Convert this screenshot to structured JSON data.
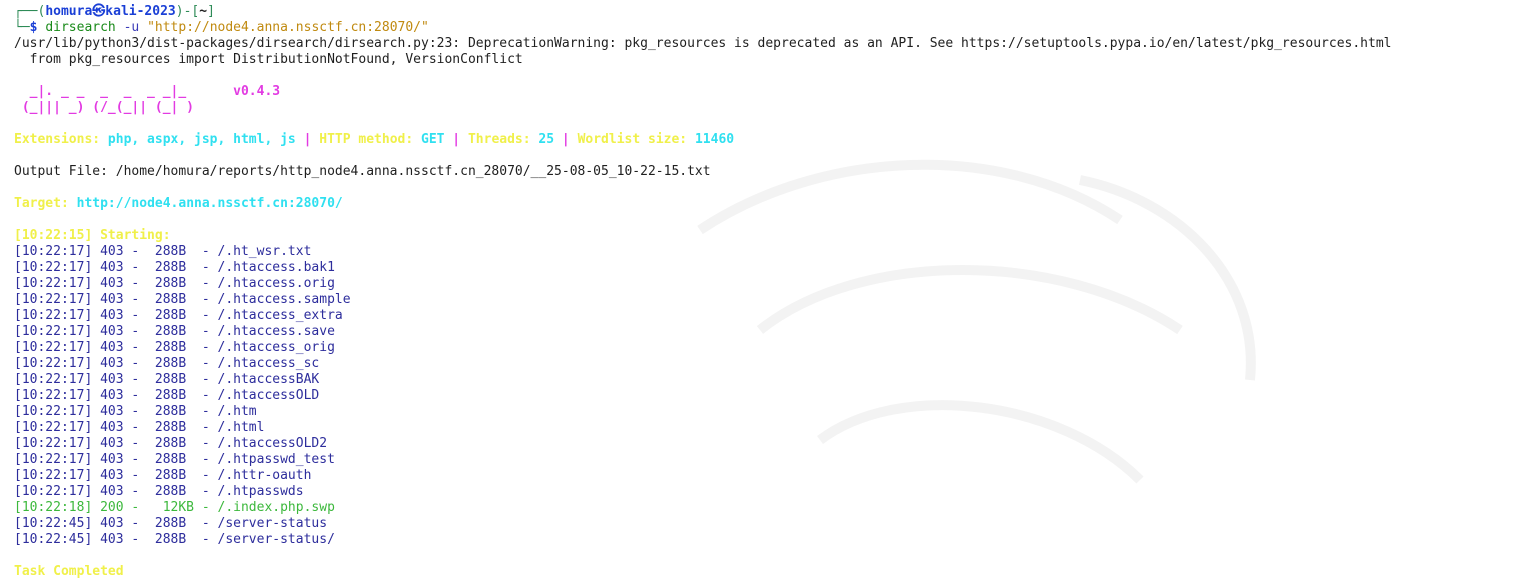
{
  "prompt": {
    "frame_top_left": "┌──(",
    "user": "homura",
    "at_symbol": "㉿",
    "host": "kali-2023",
    "mid": ")-[",
    "cwd": "~",
    "close": "]",
    "frame_bottom": "└─",
    "dollar": "$",
    "command": "dirsearch",
    "flag": "-u",
    "url_arg": "\"http://node4.anna.nssctf.cn:28070/\""
  },
  "warning": {
    "line1": "/usr/lib/python3/dist-packages/dirsearch/dirsearch.py:23: DeprecationWarning: pkg_resources is deprecated as an API. See https://setuptools.pypa.io/en/latest/pkg_resources.html",
    "line2": "  from pkg_resources import DistributionNotFound, VersionConflict"
  },
  "banner": {
    "art_line1": "  _|. _ _  _  _  _ _|_",
    "version": "v0.4.3",
    "art_line2": " (_||| _) (/_(_|| (_| )"
  },
  "config": {
    "ext_label": "Extensions: ",
    "ext_value": "php, aspx, jsp, html, js",
    "sep": " | ",
    "method_label": "HTTP method: ",
    "method_value": "GET",
    "threads_label": "Threads: ",
    "threads_value": "25",
    "wordlist_label": "Wordlist size: ",
    "wordlist_value": "11460"
  },
  "output_file": "Output File: /home/homura/reports/http_node4.anna.nssctf.cn_28070/__25-08-05_10-22-15.txt",
  "target": {
    "label": "Target: ",
    "url": "http://node4.anna.nssctf.cn:28070/"
  },
  "starting": "[10:22:15] Starting: ",
  "results": [
    {
      "text": "[10:22:17] 403 -  288B  - /.ht_wsr.txt",
      "status": "403"
    },
    {
      "text": "[10:22:17] 403 -  288B  - /.htaccess.bak1",
      "status": "403"
    },
    {
      "text": "[10:22:17] 403 -  288B  - /.htaccess.orig",
      "status": "403"
    },
    {
      "text": "[10:22:17] 403 -  288B  - /.htaccess.sample",
      "status": "403"
    },
    {
      "text": "[10:22:17] 403 -  288B  - /.htaccess_extra",
      "status": "403"
    },
    {
      "text": "[10:22:17] 403 -  288B  - /.htaccess.save",
      "status": "403"
    },
    {
      "text": "[10:22:17] 403 -  288B  - /.htaccess_orig",
      "status": "403"
    },
    {
      "text": "[10:22:17] 403 -  288B  - /.htaccess_sc",
      "status": "403"
    },
    {
      "text": "[10:22:17] 403 -  288B  - /.htaccessBAK",
      "status": "403"
    },
    {
      "text": "[10:22:17] 403 -  288B  - /.htaccessOLD",
      "status": "403"
    },
    {
      "text": "[10:22:17] 403 -  288B  - /.htm",
      "status": "403"
    },
    {
      "text": "[10:22:17] 403 -  288B  - /.html",
      "status": "403"
    },
    {
      "text": "[10:22:17] 403 -  288B  - /.htaccessOLD2",
      "status": "403"
    },
    {
      "text": "[10:22:17] 403 -  288B  - /.htpasswd_test",
      "status": "403"
    },
    {
      "text": "[10:22:17] 403 -  288B  - /.httr-oauth",
      "status": "403"
    },
    {
      "text": "[10:22:17] 403 -  288B  - /.htpasswds",
      "status": "403"
    },
    {
      "text": "[10:22:18] 200 -   12KB - /.index.php.swp",
      "status": "200"
    },
    {
      "text": "[10:22:45] 403 -  288B  - /server-status",
      "status": "403"
    },
    {
      "text": "[10:22:45] 403 -  288B  - /server-status/",
      "status": "403"
    }
  ],
  "completed": "Task Completed",
  "colors": {
    "background": "#ffffff",
    "prompt_blue": "#1a3fd6",
    "frame_green": "#2e8b57",
    "banner_magenta": "#e23be2",
    "label_yellow": "#f0f04a",
    "value_cyan": "#30e0f0",
    "status_403": "#2d2d9c",
    "status_200": "#3cb83c"
  }
}
